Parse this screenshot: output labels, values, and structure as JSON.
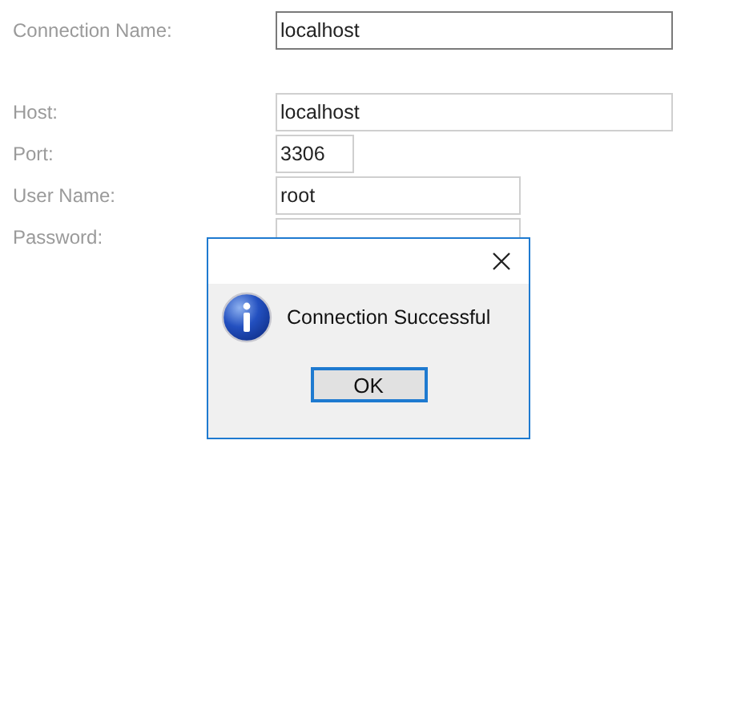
{
  "form": {
    "fields": [
      {
        "label": "Connection Name:",
        "value": "localhost",
        "kind": "name",
        "focused": true
      },
      {
        "label": "Host:",
        "value": "localhost",
        "kind": "wide",
        "focused": false
      },
      {
        "label": "Port:",
        "value": "3306",
        "kind": "short",
        "focused": false
      },
      {
        "label": "User Name:",
        "value": "root",
        "kind": "medium",
        "focused": false
      },
      {
        "label": "Password:",
        "kind": "medium",
        "focused": false
      }
    ]
  },
  "dialog": {
    "message": "Connection Successful",
    "buttons": [
      {
        "label": "OK",
        "selected": true
      }
    ]
  }
}
